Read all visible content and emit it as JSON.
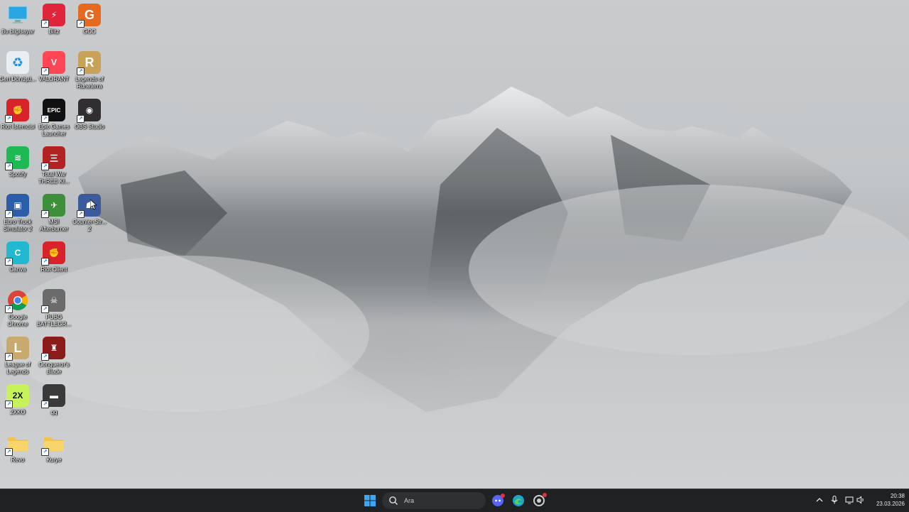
{
  "desktop": {
    "icons": [
      {
        "label": "Bu bilgisayar",
        "glyph": "monitor-icon",
        "color": "#2a9fd8"
      },
      {
        "label": "Blitz",
        "glyph": "blitz-icon",
        "color": "#e0243a"
      },
      {
        "label": "GCC",
        "glyph": "gcc-icon",
        "color": "#e56a1f"
      },
      {
        "label": "Geri Dönüşü...",
        "glyph": "recycle-bin-icon",
        "color": "#e8eef4"
      },
      {
        "label": "VALORANT",
        "glyph": "valorant-icon",
        "color": "#ff4655"
      },
      {
        "label": "Legends of Runeterra",
        "glyph": "runeterra-icon",
        "color": "#c9a25a"
      },
      {
        "label": "Riot İstemcisi",
        "glyph": "riot-client-icon",
        "color": "#d8232a"
      },
      {
        "label": "Epic Games Launcher",
        "glyph": "epic-games-icon",
        "color": "#111111"
      },
      {
        "label": "OBS Studio",
        "glyph": "obs-icon",
        "color": "#302e31"
      },
      {
        "label": "Spotify",
        "glyph": "spotify-icon",
        "color": "#1db954"
      },
      {
        "label": "Total War THREE KI...",
        "glyph": "total-war-icon",
        "color": "#b22222"
      },
      {
        "label": "Euro Truck Simulator 2",
        "glyph": "truck-icon",
        "color": "#2b5da8"
      },
      {
        "label": "MSI Afterburner",
        "glyph": "msi-afterburner-icon",
        "color": "#3e8f3a"
      },
      {
        "label": "Counter-Str... 2",
        "glyph": "counter-strike-icon",
        "color": "#3b5b9d"
      },
      {
        "label": "Canva",
        "glyph": "canva-icon",
        "color": "#22b8cf"
      },
      {
        "label": "Riot Client",
        "glyph": "riot-client-icon",
        "color": "#d8232a"
      },
      {
        "label": "Google Chrome",
        "glyph": "chrome-icon",
        "color": "#4285f4"
      },
      {
        "label": "PUBG BATTLEGR...",
        "glyph": "pubg-icon",
        "color": "#6b6b6b"
      },
      {
        "label": "League of Legends",
        "glyph": "lol-icon",
        "color": "#c8aa6e"
      },
      {
        "label": "Conqueror's Blade",
        "glyph": "conquerors-blade-icon",
        "color": "#8b1a1a"
      },
      {
        "label": "2XKO",
        "glyph": "2xko-icon",
        "color": "#c6f25a"
      },
      {
        "label": "qq",
        "glyph": "shortcut-image-icon",
        "color": "#3a3a3a"
      },
      {
        "label": "Revo",
        "glyph": "folder-icon",
        "color": "#f4c542"
      },
      {
        "label": "Kurye",
        "glyph": "folder-icon",
        "color": "#f4c542"
      }
    ]
  },
  "taskbar": {
    "search_placeholder": "Ara",
    "apps": [
      {
        "name": "discord-icon",
        "color": "#5865f2"
      },
      {
        "name": "edge-icon",
        "color": "#1fa5c9"
      },
      {
        "name": "riot-client-icon",
        "color": "#d8232a"
      }
    ],
    "clock_time": "20:38",
    "clock_date": "23.03.2026"
  }
}
